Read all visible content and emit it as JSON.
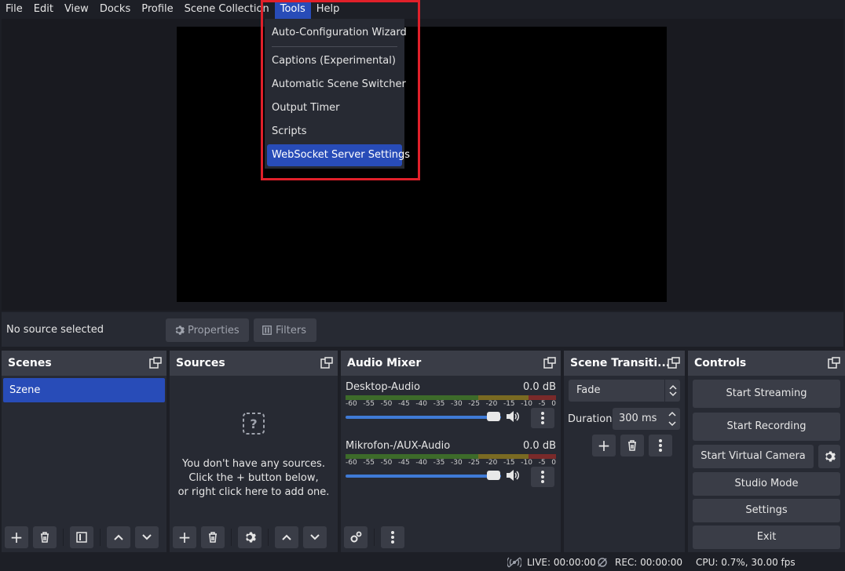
{
  "menubar": {
    "items": [
      "File",
      "Edit",
      "View",
      "Docks",
      "Profile",
      "Scene Collection",
      "Tools",
      "Help"
    ],
    "active": "Tools"
  },
  "tools_menu": {
    "items": [
      "Auto-Configuration Wizard",
      "Captions (Experimental)",
      "Automatic Scene Switcher",
      "Output Timer",
      "Scripts",
      "WebSocket Server Settings"
    ],
    "highlighted": "WebSocket Server Settings",
    "annotation_color": "#e0202a"
  },
  "sourcebar": {
    "no_source": "No source selected",
    "properties": "Properties",
    "filters": "Filters"
  },
  "scenes": {
    "title": "Scenes",
    "items": [
      "Szene"
    ]
  },
  "sources": {
    "title": "Sources",
    "empty_line1": "You don't have any sources.",
    "empty_line2": "Click the + button below,",
    "empty_line3": "or right click here to add one."
  },
  "audio_mixer": {
    "title": "Audio Mixer",
    "channels": [
      {
        "name": "Desktop-Audio",
        "db": "0.0 dB"
      },
      {
        "name": "Mikrofon-/AUX-Audio",
        "db": "0.0 dB"
      }
    ],
    "ticks": [
      "-60",
      "-55",
      "-50",
      "-45",
      "-40",
      "-35",
      "-30",
      "-25",
      "-20",
      "-15",
      "-10",
      "-5",
      "0"
    ]
  },
  "transitions": {
    "title": "Scene Transiti...",
    "selected": "Fade",
    "duration_label": "Duration",
    "duration_value": "300 ms"
  },
  "controls": {
    "title": "Controls",
    "start_streaming": "Start Streaming",
    "start_recording": "Start Recording",
    "start_virtual_camera": "Start Virtual Camera",
    "studio_mode": "Studio Mode",
    "settings": "Settings",
    "exit": "Exit"
  },
  "status": {
    "live": "LIVE: 00:00:00",
    "rec": "REC: 00:00:00",
    "cpu": "CPU: 0.7%, 30.00 fps"
  },
  "colors": {
    "accent": "#284cb8",
    "panel": "#272a33",
    "button": "#3a3d47",
    "background": "#1d1f26"
  }
}
